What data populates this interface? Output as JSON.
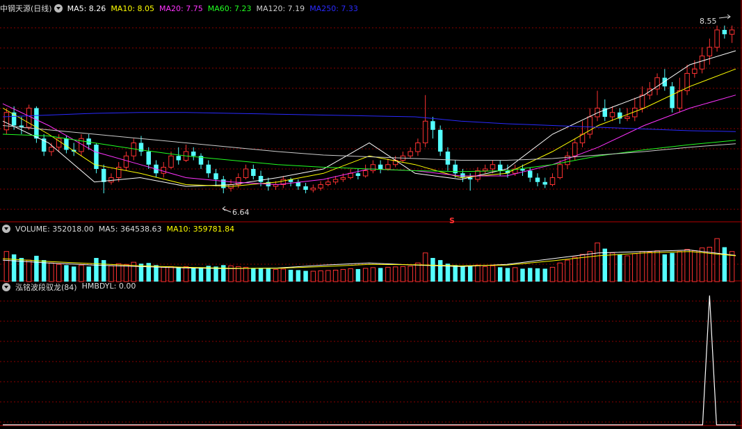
{
  "stock": {
    "name": "中钢天源",
    "period": "(日线)"
  },
  "colors": {
    "up": "#ff3232",
    "down": "#54ffff",
    "ma5": "#ffffff",
    "ma10": "#ffff00",
    "ma20": "#ff33ff",
    "ma60": "#22ff22",
    "ma120": "#cccccc",
    "ma250": "#2a2aff",
    "grid": "#8b0000",
    "border": "#b40000",
    "signal": "#ffffff"
  },
  "main_legend": [
    {
      "text": "MA5: 8.26",
      "color": "#ffffff"
    },
    {
      "text": "MA10: 8.05",
      "color": "#ffff00"
    },
    {
      "text": "MA20: 7.75",
      "color": "#ff33ff"
    },
    {
      "text": "MA60: 7.23",
      "color": "#22ff22"
    },
    {
      "text": "MA120: 7.19",
      "color": "#cccccc"
    },
    {
      "text": "MA250: 7.33",
      "color": "#2a2aff"
    }
  ],
  "volume_legend": [
    {
      "text": "VOLUME: 352018.00",
      "color": "#dddddd"
    },
    {
      "text": "MA5: 364538.63",
      "color": "#dddddd"
    },
    {
      "text": "MA10: 359781.84",
      "color": "#ffff00"
    }
  ],
  "indicator_legend": [
    {
      "text": "泓铭波段驭龙(84)",
      "color": "#dddddd"
    },
    {
      "text": "HMBDYL: 0.00",
      "color": "#dddddd"
    }
  ],
  "annotations": {
    "high": "8.55",
    "low": "6.64",
    "marker": "S"
  },
  "chart_data": {
    "type": "candlestick",
    "price_axis": [
      6.3,
      8.7
    ],
    "volume_axis": [
      0,
      650000
    ],
    "signal_axis": [
      0,
      1
    ],
    "candles": [
      [
        7.35,
        7.55,
        7.6,
        7.3,
        420000
      ],
      [
        7.55,
        7.4,
        7.62,
        7.35,
        380000
      ],
      [
        7.4,
        7.38,
        7.5,
        7.3,
        330000
      ],
      [
        7.38,
        7.6,
        7.64,
        7.35,
        300000
      ],
      [
        7.6,
        7.25,
        7.62,
        7.2,
        360000
      ],
      [
        7.25,
        7.1,
        7.3,
        7.05,
        300000
      ],
      [
        7.1,
        7.15,
        7.2,
        7.05,
        260000
      ],
      [
        7.15,
        7.25,
        7.3,
        7.1,
        240000
      ],
      [
        7.25,
        7.12,
        7.28,
        7.08,
        230000
      ],
      [
        7.12,
        7.1,
        7.2,
        7.05,
        210000
      ],
      [
        7.1,
        7.25,
        7.3,
        7.05,
        230000
      ],
      [
        7.25,
        7.18,
        7.3,
        7.12,
        210000
      ],
      [
        7.18,
        6.9,
        7.2,
        6.85,
        330000
      ],
      [
        6.9,
        6.75,
        6.95,
        6.62,
        300000
      ],
      [
        6.75,
        6.8,
        6.85,
        6.72,
        220000
      ],
      [
        6.8,
        6.92,
        6.98,
        6.75,
        250000
      ],
      [
        6.92,
        7.05,
        7.1,
        6.88,
        240000
      ],
      [
        7.05,
        7.2,
        7.25,
        7.0,
        270000
      ],
      [
        7.2,
        7.1,
        7.28,
        7.05,
        250000
      ],
      [
        7.1,
        6.95,
        7.15,
        6.9,
        260000
      ],
      [
        6.95,
        6.85,
        7.0,
        6.8,
        230000
      ],
      [
        6.85,
        6.92,
        6.98,
        6.8,
        200000
      ],
      [
        6.92,
        7.05,
        7.1,
        6.9,
        210000
      ],
      [
        7.05,
        7.0,
        7.15,
        6.95,
        200000
      ],
      [
        7.0,
        7.1,
        7.18,
        6.98,
        210000
      ],
      [
        7.1,
        7.05,
        7.15,
        7.0,
        190000
      ],
      [
        7.05,
        6.95,
        7.08,
        6.9,
        200000
      ],
      [
        6.95,
        6.85,
        7.0,
        6.8,
        220000
      ],
      [
        6.85,
        6.78,
        6.9,
        6.7,
        210000
      ],
      [
        6.78,
        6.68,
        6.82,
        6.62,
        230000
      ],
      [
        6.68,
        6.72,
        6.78,
        6.64,
        220000
      ],
      [
        6.72,
        6.8,
        6.85,
        6.68,
        210000
      ],
      [
        6.8,
        6.9,
        6.95,
        6.78,
        200000
      ],
      [
        6.9,
        6.82,
        6.95,
        6.78,
        190000
      ],
      [
        6.82,
        6.75,
        6.88,
        6.7,
        190000
      ],
      [
        6.75,
        6.7,
        6.8,
        6.65,
        180000
      ],
      [
        6.7,
        6.72,
        6.76,
        6.66,
        170000
      ],
      [
        6.72,
        6.78,
        6.82,
        6.68,
        175000
      ],
      [
        6.78,
        6.75,
        6.8,
        6.7,
        165000
      ],
      [
        6.75,
        6.7,
        6.78,
        6.66,
        160000
      ],
      [
        6.7,
        6.66,
        6.74,
        6.62,
        150000
      ],
      [
        6.66,
        6.68,
        6.72,
        6.63,
        145000
      ],
      [
        6.68,
        6.72,
        6.76,
        6.65,
        150000
      ],
      [
        6.72,
        6.75,
        6.8,
        6.7,
        155000
      ],
      [
        6.75,
        6.78,
        6.82,
        6.72,
        160000
      ],
      [
        6.78,
        6.8,
        6.85,
        6.75,
        170000
      ],
      [
        6.8,
        6.85,
        6.9,
        6.78,
        180000
      ],
      [
        6.85,
        6.82,
        6.9,
        6.78,
        175000
      ],
      [
        6.82,
        6.88,
        6.95,
        6.8,
        185000
      ],
      [
        6.88,
        6.95,
        7.0,
        6.85,
        195000
      ],
      [
        6.95,
        6.9,
        7.0,
        6.85,
        190000
      ],
      [
        6.9,
        6.95,
        7.02,
        6.88,
        200000
      ],
      [
        6.95,
        7.0,
        7.05,
        6.92,
        205000
      ],
      [
        7.0,
        7.05,
        7.1,
        6.98,
        210000
      ],
      [
        7.05,
        7.1,
        7.15,
        7.02,
        215000
      ],
      [
        7.1,
        7.2,
        7.25,
        7.05,
        260000
      ],
      [
        7.2,
        7.45,
        7.75,
        7.15,
        400000
      ],
      [
        7.45,
        7.35,
        7.5,
        7.25,
        330000
      ],
      [
        7.35,
        7.1,
        7.4,
        7.05,
        300000
      ],
      [
        7.1,
        6.95,
        7.15,
        6.88,
        250000
      ],
      [
        6.95,
        6.85,
        7.0,
        6.8,
        230000
      ],
      [
        6.85,
        6.8,
        6.9,
        6.75,
        210000
      ],
      [
        6.8,
        6.78,
        6.85,
        6.65,
        220000
      ],
      [
        6.78,
        6.88,
        6.92,
        6.75,
        230000
      ],
      [
        6.88,
        6.9,
        6.95,
        6.85,
        210000
      ],
      [
        6.9,
        6.95,
        7.0,
        6.85,
        220000
      ],
      [
        6.95,
        6.88,
        7.0,
        6.82,
        200000
      ],
      [
        6.88,
        6.85,
        6.95,
        6.8,
        190000
      ],
      [
        6.85,
        6.9,
        6.95,
        6.82,
        195000
      ],
      [
        6.9,
        6.88,
        6.95,
        6.82,
        180000
      ],
      [
        6.88,
        6.8,
        6.92,
        6.75,
        190000
      ],
      [
        6.8,
        6.75,
        6.85,
        6.7,
        185000
      ],
      [
        6.75,
        6.72,
        6.8,
        6.68,
        180000
      ],
      [
        6.72,
        6.8,
        6.85,
        6.7,
        200000
      ],
      [
        6.8,
        6.95,
        7.0,
        6.78,
        260000
      ],
      [
        6.95,
        7.05,
        7.1,
        6.9,
        300000
      ],
      [
        7.05,
        7.2,
        7.25,
        7.0,
        340000
      ],
      [
        7.2,
        7.3,
        7.45,
        7.15,
        380000
      ],
      [
        7.3,
        7.5,
        7.6,
        7.25,
        420000
      ],
      [
        7.5,
        7.6,
        7.8,
        7.45,
        540000
      ],
      [
        7.6,
        7.5,
        7.7,
        7.45,
        460000
      ],
      [
        7.5,
        7.55,
        7.62,
        7.45,
        400000
      ],
      [
        7.55,
        7.48,
        7.6,
        7.42,
        380000
      ],
      [
        7.48,
        7.5,
        7.6,
        7.45,
        360000
      ],
      [
        7.5,
        7.6,
        7.72,
        7.45,
        390000
      ],
      [
        7.6,
        7.75,
        7.85,
        7.55,
        420000
      ],
      [
        7.75,
        7.82,
        7.9,
        7.7,
        410000
      ],
      [
        7.82,
        7.95,
        8.0,
        7.75,
        430000
      ],
      [
        7.95,
        7.85,
        8.05,
        7.8,
        380000
      ],
      [
        7.85,
        7.6,
        7.9,
        7.55,
        400000
      ],
      [
        7.6,
        7.8,
        7.95,
        7.55,
        420000
      ],
      [
        7.8,
        8.0,
        8.1,
        7.75,
        450000
      ],
      [
        8.0,
        8.05,
        8.15,
        7.95,
        430000
      ],
      [
        8.05,
        8.2,
        8.3,
        8.0,
        470000
      ],
      [
        8.2,
        8.3,
        8.4,
        8.1,
        480000
      ],
      [
        8.3,
        8.5,
        8.55,
        8.25,
        600000
      ],
      [
        8.5,
        8.45,
        8.55,
        8.4,
        480000
      ],
      [
        8.45,
        8.5,
        8.55,
        8.35,
        420000
      ]
    ],
    "moving_averages": [
      {
        "name": "MA5",
        "color": "#ffffff",
        "values": [
          7.45,
          7.2,
          6.75,
          6.8,
          6.7,
          6.72,
          6.8,
          6.9,
          7.2,
          6.85,
          6.78,
          6.9,
          7.3,
          7.55,
          7.75,
          8.1,
          8.26
        ]
      },
      {
        "name": "MA10",
        "color": "#ffff00",
        "values": [
          7.6,
          7.3,
          6.95,
          6.85,
          6.72,
          6.7,
          6.75,
          6.85,
          7.05,
          6.95,
          6.8,
          6.85,
          7.1,
          7.4,
          7.6,
          7.85,
          8.05
        ]
      },
      {
        "name": "MA20",
        "color": "#ff33ff",
        "values": [
          7.65,
          7.4,
          7.1,
          6.95,
          6.8,
          6.75,
          6.72,
          6.78,
          6.9,
          6.88,
          6.82,
          6.82,
          6.95,
          7.15,
          7.4,
          7.6,
          7.75
        ]
      },
      {
        "name": "MA60",
        "color": "#22ff22",
        "values": [
          7.3,
          7.28,
          7.2,
          7.12,
          7.05,
          7.0,
          6.95,
          6.92,
          6.9,
          6.88,
          6.87,
          6.88,
          6.95,
          7.05,
          7.12,
          7.18,
          7.23
        ]
      },
      {
        "name": "MA120",
        "color": "#cccccc",
        "values": [
          7.4,
          7.35,
          7.3,
          7.25,
          7.2,
          7.15,
          7.1,
          7.06,
          7.04,
          7.02,
          7.0,
          7.0,
          7.02,
          7.06,
          7.1,
          7.15,
          7.19
        ]
      },
      {
        "name": "MA250",
        "color": "#2a2aff",
        "values": [
          7.5,
          7.52,
          7.54,
          7.55,
          7.55,
          7.54,
          7.53,
          7.52,
          7.51,
          7.5,
          7.45,
          7.42,
          7.4,
          7.38,
          7.36,
          7.34,
          7.33
        ]
      }
    ],
    "volume_ma": [
      {
        "name": "MA5",
        "color": "#ffffff",
        "values": [
          300000,
          260000,
          230000,
          210000,
          190000,
          180000,
          190000,
          230000,
          260000,
          230000,
          210000,
          240000,
          320000,
          400000,
          420000,
          440000,
          364538
        ]
      },
      {
        "name": "MA10",
        "color": "#ffff00",
        "values": [
          320000,
          280000,
          250000,
          220000,
          200000,
          185000,
          185000,
          210000,
          240000,
          235000,
          220000,
          230000,
          290000,
          360000,
          400000,
          420000,
          359781
        ]
      }
    ],
    "signal_values_note_only_last_spike": true,
    "signal_spike_index": 94
  }
}
